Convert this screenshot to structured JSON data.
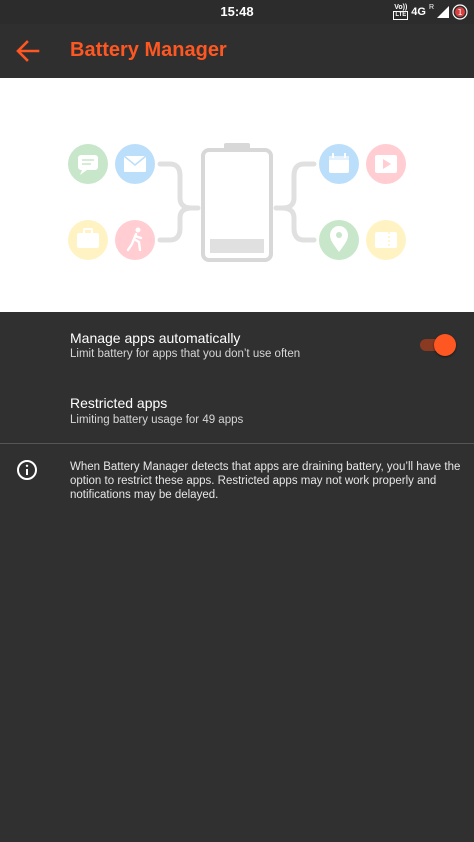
{
  "status_bar": {
    "time": "15:48",
    "volte_top": "Vo))",
    "volte_bottom": "LTE",
    "network": "4G",
    "roaming": "R",
    "notification_badge": "1"
  },
  "app_bar": {
    "title": "Battery Manager",
    "back_icon": "arrow-back-icon"
  },
  "hero": {
    "left_icons": [
      "message-icon",
      "email-icon",
      "briefcase-icon",
      "running-icon"
    ],
    "right_icons": [
      "calendar-icon",
      "play-icon",
      "map-pin-icon",
      "ticket-icon"
    ]
  },
  "settings": {
    "manage_apps": {
      "title": "Manage apps automatically",
      "subtitle": "Limit battery for apps that you don’t use often",
      "enabled": true
    },
    "restricted_apps": {
      "title": "Restricted apps",
      "subtitle": "Limiting battery usage for 49 apps"
    }
  },
  "info": {
    "text": "When Battery Manager detects that apps are draining battery, you’ll have the option to restrict these apps. Restricted apps may not work properly and notifications may be delayed."
  },
  "colors": {
    "accent": "#ff5722",
    "background": "#303030",
    "hero_bg": "#ffffff",
    "green_tint": "#c8e6c9",
    "blue_tint": "#bbdefb",
    "yellow_tint": "#fff3c4",
    "red_tint": "#ffcdd2"
  }
}
